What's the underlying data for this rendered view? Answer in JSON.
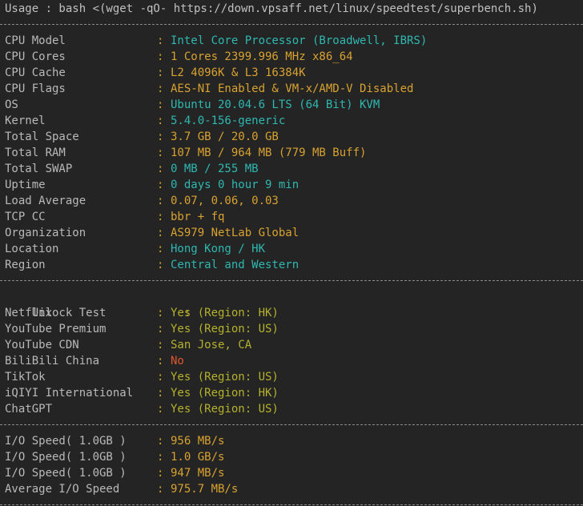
{
  "usage_line": "Usage : bash <(wget -qO- https://down.vpsaff.net/linux/speedtest/superbench.sh)",
  "system_info": [
    {
      "label": "CPU Model",
      "value": "Intel Core Processor (Broadwell, IBRS)",
      "color": "cyan"
    },
    {
      "label": "CPU Cores",
      "value": "1 Cores 2399.996 MHz x86_64",
      "color": "yellow"
    },
    {
      "label": "CPU Cache",
      "value": "L2 4096K & L3 16384K",
      "color": "yellow"
    },
    {
      "label": "CPU Flags",
      "value": "AES-NI Enabled & VM-x/AMD-V Disabled",
      "color": "yellow"
    },
    {
      "label": "OS",
      "value": "Ubuntu 20.04.6 LTS (64 Bit) KVM",
      "color": "cyan"
    },
    {
      "label": "Kernel",
      "value": "5.4.0-156-generic",
      "color": "cyan"
    },
    {
      "label": "Total Space",
      "value": "3.7 GB / 20.0 GB",
      "color": "yellow"
    },
    {
      "label": "Total RAM",
      "value": "107 MB / 964 MB (779 MB Buff)",
      "color": "yellow"
    },
    {
      "label": "Total SWAP",
      "value": "0 MB / 255 MB",
      "color": "cyan"
    },
    {
      "label": "Uptime",
      "value": "0 days 0 hour 9 min",
      "color": "cyan"
    },
    {
      "label": "Load Average",
      "value": "0.07, 0.06, 0.03",
      "color": "yellow"
    },
    {
      "label": "TCP CC",
      "value": "bbr + fq",
      "color": "yellow"
    },
    {
      "label": "Organization",
      "value": "AS979 NetLab Global",
      "color": "yellow"
    },
    {
      "label": "Location",
      "value": "Hong Kong / HK",
      "color": "cyan"
    },
    {
      "label": "Region",
      "value": "Central and Western",
      "color": "cyan"
    }
  ],
  "unlock_test": {
    "header_label": "Unlock Test",
    "items": [
      {
        "label": "Netflix",
        "value": "Yes (Region: HK)",
        "color": "olive"
      },
      {
        "label": "YouTube Premium",
        "value": "Yes (Region: US)",
        "color": "olive"
      },
      {
        "label": "YouTube CDN",
        "value": "San Jose, CA",
        "color": "olive"
      },
      {
        "label": "BiliBili China",
        "value": "No",
        "color": "red"
      },
      {
        "label": "TikTok",
        "value": "Yes (Region: US)",
        "color": "olive"
      },
      {
        "label": "iQIYI International",
        "value": "Yes (Region: HK)",
        "color": "olive"
      },
      {
        "label": "ChatGPT",
        "value": "Yes (Region: US)",
        "color": "olive"
      }
    ]
  },
  "io_speed": [
    {
      "label": "I/O Speed( 1.0GB )",
      "value": "956 MB/s",
      "color": "yellow"
    },
    {
      "label": "I/O Speed( 1.0GB )",
      "value": "1.0 GB/s",
      "color": "yellow"
    },
    {
      "label": "I/O Speed( 1.0GB )",
      "value": "947 MB/s",
      "color": "yellow"
    },
    {
      "label": "Average I/O Speed",
      "value": "975.7 MB/s",
      "color": "yellow"
    }
  ],
  "colon": ":",
  "colors": {
    "background": "#242424",
    "label": "#b9b9b9",
    "cyan": "#2eb8b0",
    "yellow": "#d8a230",
    "olive": "#b5b12c",
    "red": "#e0552d",
    "separator": "#8a8a8a"
  }
}
